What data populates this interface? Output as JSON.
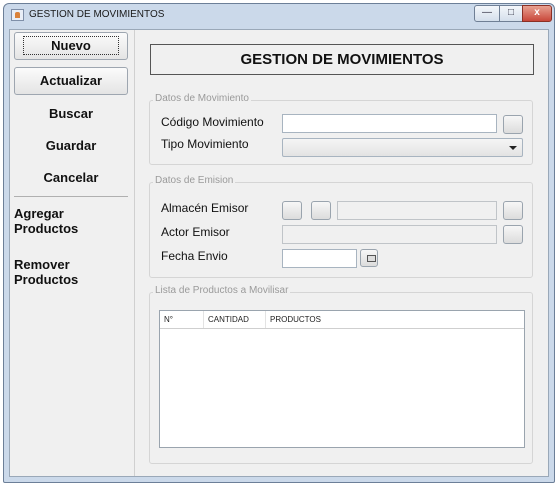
{
  "window": {
    "title": "GESTION DE MOVIMIENTOS",
    "controls": {
      "minimize": "—",
      "maximize": "□",
      "close": "x"
    }
  },
  "sidebar": {
    "nuevo": "Nuevo",
    "actualizar": "Actualizar",
    "buscar": "Buscar",
    "guardar": "Guardar",
    "cancelar": "Cancelar",
    "agregar_line1": "Agregar",
    "agregar_line2": "Productos",
    "remover_line1": "Remover",
    "remover_line2": "Productos"
  },
  "header": {
    "title": "GESTION DE MOVIMIENTOS"
  },
  "datos_movimiento": {
    "group_title": "Datos de Movimiento",
    "codigo_label": "Código Movimiento",
    "codigo_value": "",
    "tipo_label": "Tipo Movimiento",
    "tipo_value": ""
  },
  "datos_emision": {
    "group_title": "Datos de Emision",
    "almacen_label": "Almacén Emisor",
    "almacen_value": "",
    "actor_label": "Actor Emisor",
    "actor_value": "",
    "fecha_label": "Fecha Envio",
    "fecha_value": ""
  },
  "lista": {
    "group_title": "Lista de Productos a Movilisar",
    "columns": [
      "N°",
      "CANTIDAD",
      "PRODUCTOS"
    ],
    "rows": []
  },
  "colors": {
    "frame": "#cbd9ea",
    "panel": "#f0f0f0",
    "close_button": "#c8473a"
  }
}
